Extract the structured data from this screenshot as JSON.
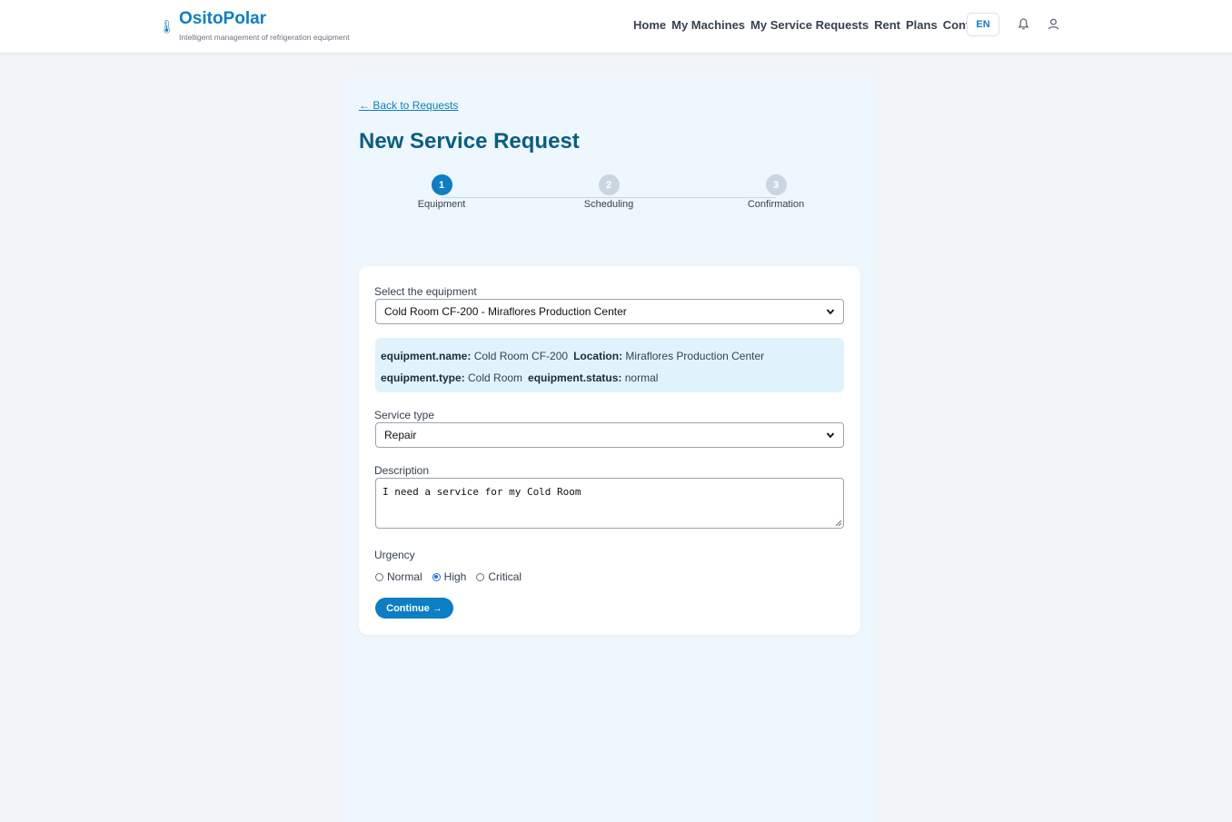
{
  "brand": {
    "name": "OsitoPolar",
    "tagline": "Intelligent management of refrigeration equipment",
    "icon": "thermometer-icon"
  },
  "nav": {
    "items": [
      "Home",
      "My Machines",
      "My Service Requests",
      "Rent",
      "Plans",
      "Contact"
    ]
  },
  "header": {
    "language": "EN",
    "bell_icon": "bell-icon",
    "user_icon": "user-icon"
  },
  "page": {
    "back_link": "← Back to Requests",
    "title": "New Service Request"
  },
  "stepper": {
    "steps": [
      {
        "number": "1",
        "label": "Equipment",
        "active": true
      },
      {
        "number": "2",
        "label": "Scheduling",
        "active": false
      },
      {
        "number": "3",
        "label": "Confirmation",
        "active": false
      }
    ]
  },
  "form": {
    "equipment_label": "Select the equipment",
    "equipment_value": "Cold Room CF-200 - Miraflores Production Center",
    "info": {
      "name_key": "equipment.name:",
      "name_value": "Cold Room CF-200",
      "location_key": "Location:",
      "location_value": "Miraflores Production Center",
      "type_key": "equipment.type:",
      "type_value": "Cold Room",
      "status_key": "equipment.status:",
      "status_value": "normal"
    },
    "service_type_label": "Service type",
    "service_type_value": "Repair",
    "description_label": "Description",
    "description_value": "I need a service for my Cold Room",
    "urgency_label": "Urgency",
    "urgency_options": [
      "Normal",
      "High",
      "Critical"
    ],
    "urgency_selected": "High",
    "continue_label": "Continue →"
  },
  "colors": {
    "accent": "#0b7ec4",
    "title": "#075e85",
    "panel": "#eef7fd",
    "info_bg": "#e0f3fc"
  }
}
